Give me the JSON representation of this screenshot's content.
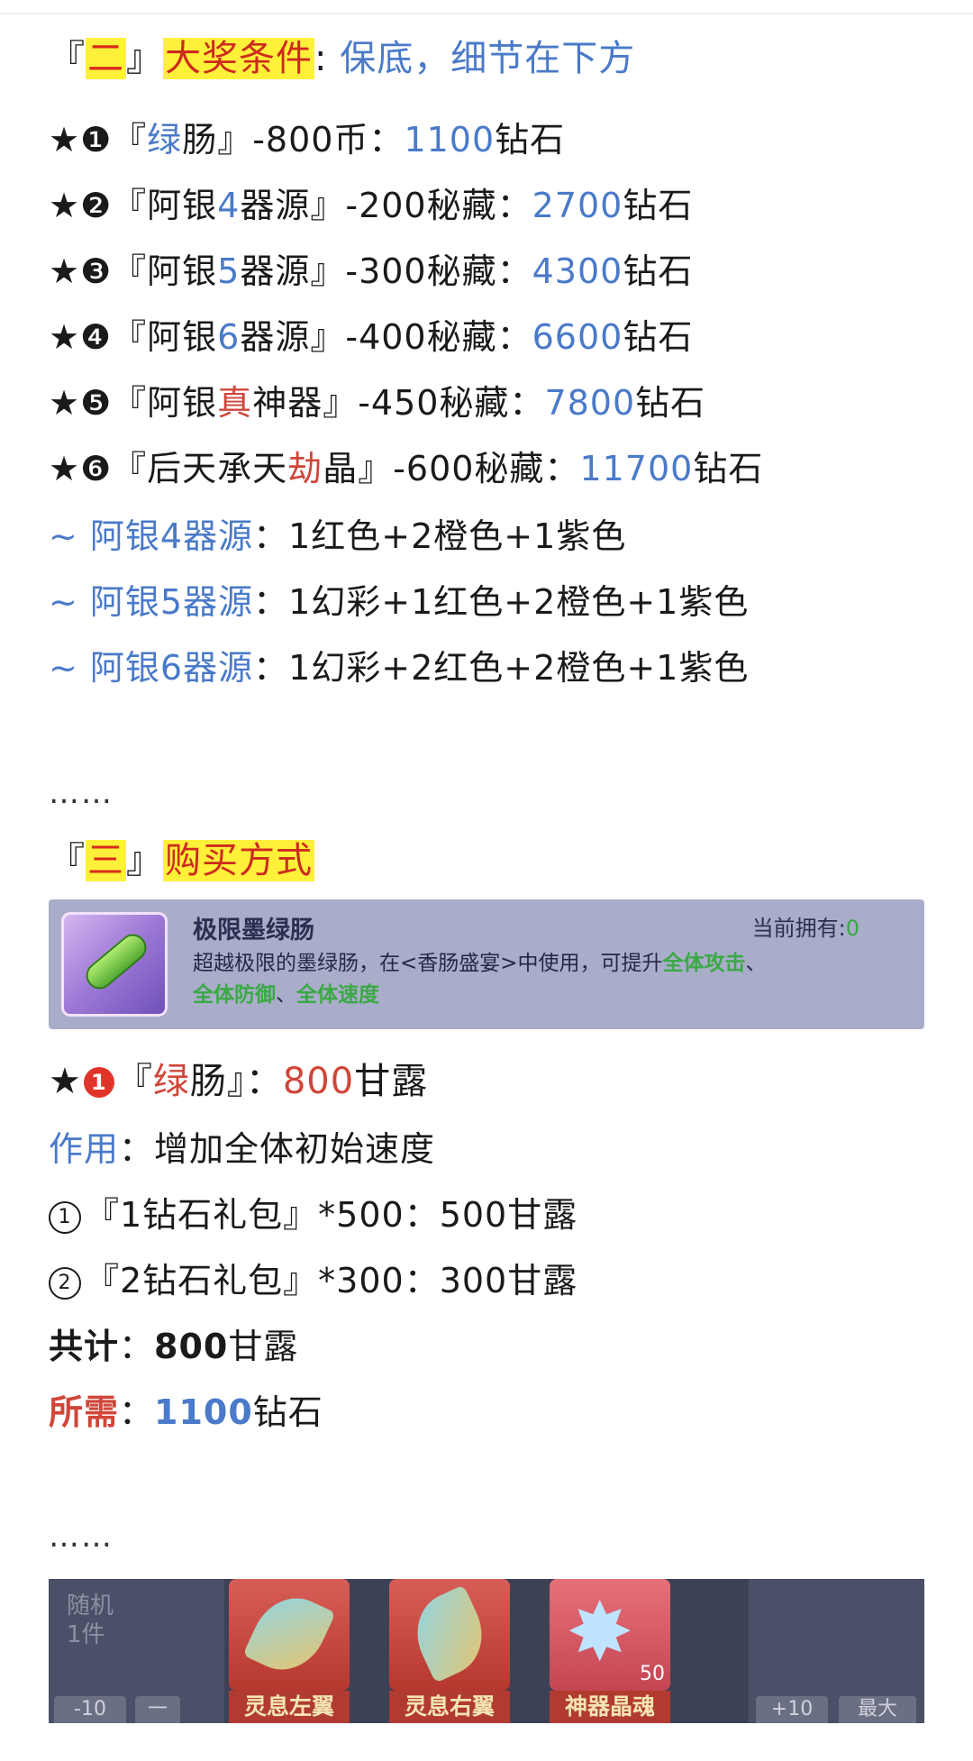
{
  "section2": {
    "bracket_open": "『",
    "num": "二",
    "bracket_close": "』",
    "title": "大奖条件",
    "colon": ":",
    "subtitle": "保底，细节在下方"
  },
  "rewards": [
    {
      "star": "★",
      "num": "❶",
      "pre": "『",
      "a": "绿",
      "b": "肠』-800币：",
      "cost": "1100",
      "unit": "钻石"
    },
    {
      "star": "★",
      "num": "❷",
      "pre": "『阿银",
      "a": "4",
      "b": "器源』-200秘藏：",
      "cost": "2700",
      "unit": "钻石"
    },
    {
      "star": "★",
      "num": "❸",
      "pre": "『阿银",
      "a": "5",
      "b": "器源』-300秘藏：",
      "cost": "4300",
      "unit": "钻石"
    },
    {
      "star": "★",
      "num": "❹",
      "pre": "『阿银",
      "a": "6",
      "b": "器源』-400秘藏：",
      "cost": "6600",
      "unit": "钻石"
    },
    {
      "star": "★",
      "num": "❺",
      "pre": "『阿银",
      "a": "真",
      "b": "神器』-450秘藏：",
      "cost": "7800",
      "unit": "钻石"
    },
    {
      "star": "★",
      "num": "❻",
      "pre": "『后天承天",
      "a": "劫",
      "b": "晶』-600秘藏：",
      "cost": "11700",
      "unit": "钻石"
    }
  ],
  "sources": [
    {
      "label": "~ 阿银4器源",
      "text": "：1红色+2橙色+1紫色"
    },
    {
      "label": "~ 阿银5器源",
      "text": "：1幻彩+1红色+2橙色+1紫色"
    },
    {
      "label": "~ 阿银6器源",
      "text": "：1幻彩+2红色+2橙色+1紫色"
    }
  ],
  "ellipsis": "……",
  "section3": {
    "bracket_open": "『",
    "num": "三",
    "bracket_close": "』",
    "title": "购买方式"
  },
  "card": {
    "title": "极限墨绿肠",
    "owned_label": "当前拥有:",
    "owned_value": "0",
    "desc_1": "超越极限的墨绿肠，在<香肠盛宴>中使用，可提升",
    "desc_g1": "全体攻击",
    "desc_sep1": "、",
    "desc_g2": "全体防御",
    "desc_sep2": "、",
    "desc_g3": "全体速度"
  },
  "buy": {
    "star": "★",
    "num": "1",
    "pre": "『",
    "a": "绿",
    "b": "肠』：",
    "cost": "800",
    "unit": "甘露",
    "effect_label": "作用",
    "effect_text": "：增加全体初始速度",
    "pack1": "『1钻石礼包』*500：500甘露",
    "pack1_num": "1",
    "pack2": "『2钻石礼包』*300：300甘露",
    "pack2_num": "2",
    "total_label": "共计",
    "total_colon": "：",
    "total_value": "800",
    "total_unit": "甘露",
    "need_label": "所需",
    "need_colon": "：",
    "need_value": "1100",
    "need_unit": "钻石"
  },
  "strip": {
    "random_1": "随机",
    "random_2": "1件",
    "items": [
      {
        "name": "灵息左翼"
      },
      {
        "name": "灵息右翼"
      },
      {
        "name": "神器晶魂",
        "count": "50"
      }
    ],
    "btn_minus10": "-10",
    "btn_minus": "一",
    "btn_plus10": "+10",
    "btn_max": "最大"
  }
}
